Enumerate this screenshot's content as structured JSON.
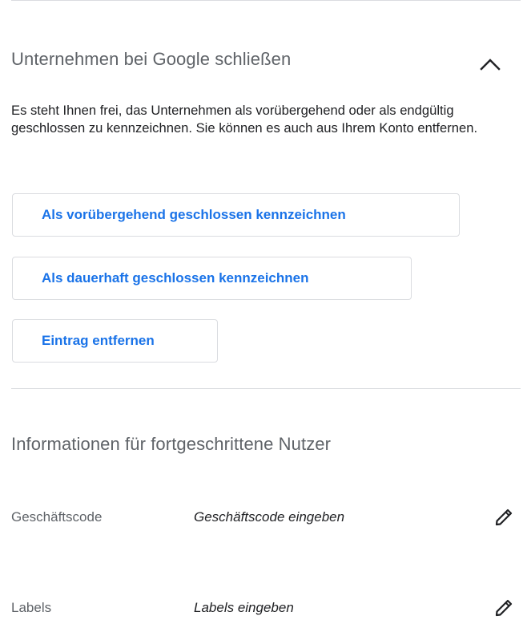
{
  "close_section": {
    "title": "Unternehmen bei Google schließen",
    "collapse_icon": "chevron-up-icon",
    "description": "Es steht Ihnen frei, das Unternehmen als vorübergehend oder als endgültig geschlossen zu kennzeichnen. Sie können es auch aus Ihrem Konto entfernen.",
    "buttons": {
      "temporarily_closed": "Als vorübergehend geschlossen kennzeichnen",
      "permanently_closed": "Als dauerhaft geschlossen kennzeichnen",
      "remove_listing": "Eintrag entfernen"
    }
  },
  "advanced_section": {
    "title": "Informationen für fortgeschrittene Nutzer",
    "fields": [
      {
        "label": "Geschäftscode",
        "value": "Geschäftscode eingeben",
        "edit_icon": "pencil-icon"
      },
      {
        "label": "Labels",
        "value": "Labels eingeben",
        "edit_icon": "pencil-icon"
      }
    ]
  },
  "colors": {
    "accent": "#1a73e8",
    "border": "#dadce0",
    "secondary_text": "#5f6368",
    "primary_text": "#202124"
  }
}
